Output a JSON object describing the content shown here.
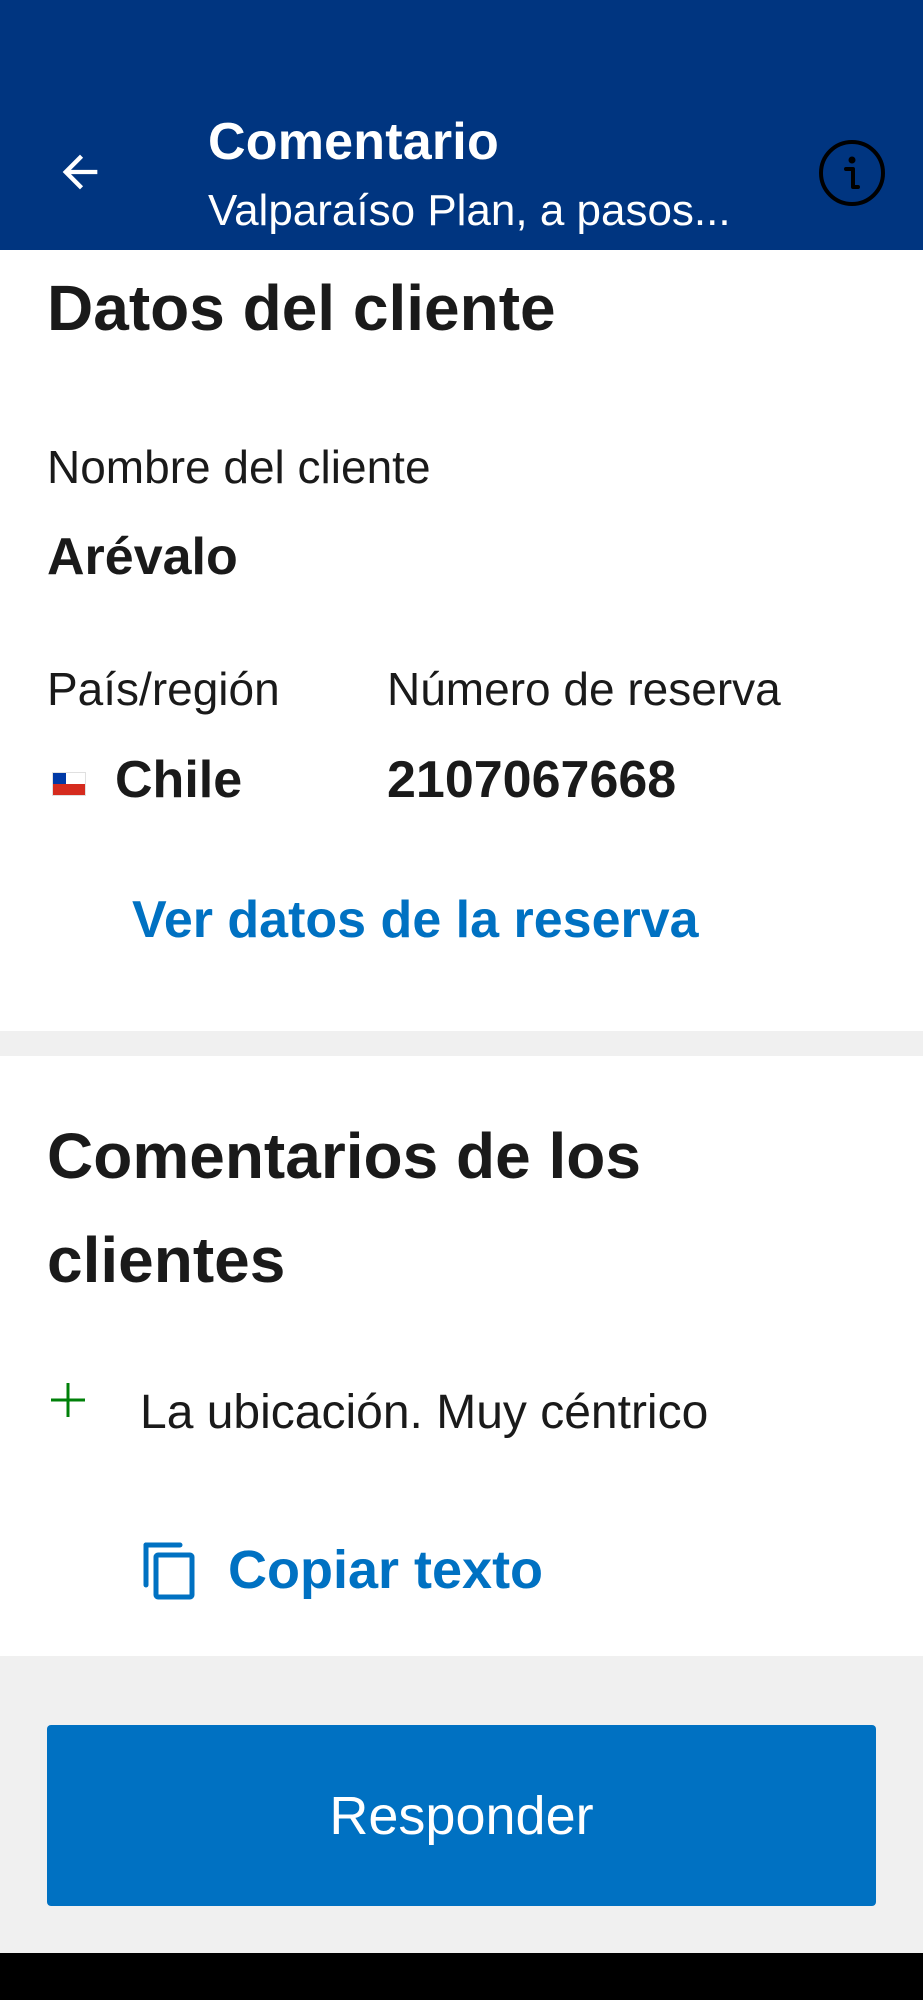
{
  "header": {
    "title": "Comentario",
    "subtitle": "Valparaíso Plan, a pasos...",
    "back_icon": "arrow-left-icon",
    "info_icon": "info-icon"
  },
  "client": {
    "section_title": "Datos del cliente",
    "name_label": "Nombre del cliente",
    "name_value": "Arévalo",
    "country_label": "País/región",
    "country_value": "Chile",
    "reservation_label": "Número de reserva",
    "reservation_value": "2107067668",
    "view_link": "Ver datos de la reserva"
  },
  "comments": {
    "section_title_line1": "Comentarios de los",
    "section_title_line2": "clientes",
    "positive_comment": "La ubicación. Muy céntrico",
    "copy_label": "Copiar texto"
  },
  "actions": {
    "reply_label": "Responder"
  },
  "colors": {
    "header_bg": "#003580",
    "accent": "#0071c2",
    "positive": "#008009"
  }
}
